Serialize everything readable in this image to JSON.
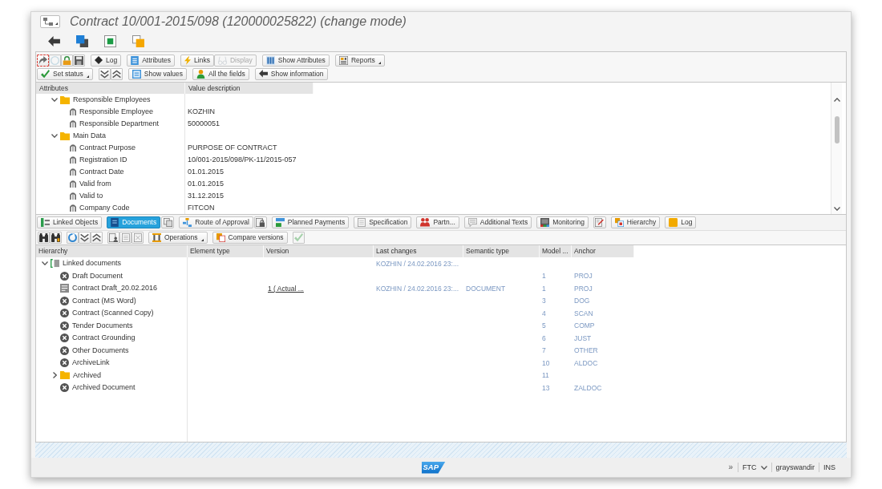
{
  "window": {
    "title": "Contract 10/001-2015/098 (120000025822) (change mode)"
  },
  "attributes_toolbar": {
    "row_1": [
      [
        {
          "kind": "icon",
          "disabled": false,
          "focused": true
        },
        {
          "kind": "icon",
          "disabled": true,
          "focused": false
        },
        {
          "kind": "icon",
          "disabled": false,
          "focused": false
        },
        {
          "kind": "icon",
          "disabled": false,
          "focused": false
        }
      ],
      [
        {
          "kind": "button",
          "label": "Log",
          "disabled": false,
          "focused": false
        }
      ],
      [
        {
          "kind": "button",
          "label": "Attributes",
          "disabled": false,
          "focused": false
        }
      ],
      [
        {
          "kind": "button",
          "label": "Links",
          "disabled": false,
          "focused": false
        },
        {
          "kind": "button",
          "label": "Display",
          "disabled": true,
          "focused": false
        }
      ],
      [
        {
          "kind": "button",
          "label": "Show Attributes",
          "disabled": false,
          "focused": false
        }
      ],
      [
        {
          "kind": "menu",
          "label": "Reports",
          "disabled": false,
          "focused": false
        }
      ]
    ],
    "row_2": [
      [
        {
          "kind": "menu",
          "label": "Set status"
        }
      ],
      [
        {
          "kind": "icon"
        },
        {
          "kind": "icon"
        }
      ],
      [
        {
          "kind": "button",
          "label": "Show values"
        }
      ],
      [
        {
          "kind": "button",
          "label": "All the fields"
        }
      ],
      [
        {
          "kind": "button",
          "label": "Show information"
        }
      ]
    ]
  },
  "attributes": {
    "columns": [
      "Attributes",
      "Value description"
    ],
    "tree": [
      {
        "name": "Responsible Employees",
        "expanded": true,
        "children": [
          {
            "name": "Responsible Employee",
            "value": "KOZHIN"
          },
          {
            "name": "Responsible Department",
            "value": "50000051"
          }
        ]
      },
      {
        "name": "Main Data",
        "expanded": true,
        "children": [
          {
            "name": "Contract Purpose",
            "value": "PURPOSE OF CONTRACT"
          },
          {
            "name": "Registration ID",
            "value": "10/001-2015/098/PK-11/2015-057"
          },
          {
            "name": "Contract Date",
            "value": "01.01.2015"
          },
          {
            "name": "Valid from",
            "value": "01.01.2015"
          },
          {
            "name": "Valid to",
            "value": "31.12.2015"
          },
          {
            "name": "Company Code",
            "value": "FITCON"
          }
        ]
      }
    ]
  },
  "tabs": [
    [
      {
        "kind": "tab",
        "label": "Linked Objects",
        "selected": false
      }
    ],
    [
      {
        "kind": "tab",
        "label": "Documents",
        "selected": true
      },
      {
        "kind": "icon",
        "selected": false
      }
    ],
    [
      {
        "kind": "tab",
        "label": "Route of Approval",
        "selected": false
      },
      {
        "kind": "icon",
        "selected": false
      }
    ],
    [
      {
        "kind": "tab",
        "label": "Planned Payments",
        "selected": false
      }
    ],
    [
      {
        "kind": "tab",
        "label": "Specification",
        "selected": false
      }
    ],
    [
      {
        "kind": "tab",
        "label": "Partn...",
        "selected": false
      }
    ],
    [
      {
        "kind": "tab",
        "label": "Additional Texts",
        "selected": false
      }
    ],
    [
      {
        "kind": "tab",
        "label": "Monitoring",
        "selected": false
      }
    ],
    [
      {
        "kind": "icon",
        "selected": false
      }
    ],
    [
      {
        "kind": "tab",
        "label": "Hierarchy",
        "selected": false
      }
    ],
    [
      {
        "kind": "tab",
        "label": "Log",
        "selected": false
      }
    ]
  ],
  "documents_toolbar": [
    [
      {
        "kind": "icon",
        "disabled": false
      },
      {
        "kind": "icon",
        "disabled": false
      }
    ],
    [
      {
        "kind": "icon",
        "disabled": false
      },
      {
        "kind": "icon",
        "disabled": false
      },
      {
        "kind": "icon",
        "disabled": false
      }
    ],
    [
      {
        "kind": "icon",
        "disabled": false
      },
      {
        "kind": "icon",
        "disabled": false
      },
      {
        "kind": "icon",
        "disabled": false
      }
    ],
    [
      {
        "kind": "menu",
        "label": "Operations",
        "disabled": false
      }
    ],
    [
      {
        "kind": "button",
        "label": "Compare versions",
        "disabled": false
      }
    ],
    [
      {
        "kind": "icon",
        "disabled": true
      }
    ]
  ],
  "documents": {
    "columns": [
      "Hierarchy",
      "Element type",
      "Version",
      "Last changes",
      "Semantic type",
      "Model ...",
      "Anchor"
    ],
    "tree": [
      {
        "kind": "root",
        "name": "Linked documents",
        "expanded": true,
        "last_changes": "KOZHIN / 24.02.2016 23:...",
        "children": [
          {
            "kind": "item",
            "name": "Draft Document",
            "model": "1",
            "anchor": "PROJ"
          },
          {
            "kind": "document",
            "name": "Contract Draft_20.02.2016",
            "version": "1 ( Actual ...",
            "last_changes": "KOZHIN / 24.02.2016 23:...",
            "semantic_type": "DOCUMENT",
            "model": "1",
            "anchor": "PROJ"
          },
          {
            "kind": "item",
            "name": "Contract (MS Word)",
            "model": "3",
            "anchor": "DOG"
          },
          {
            "kind": "item",
            "name": "Contract (Scanned Copy)",
            "model": "4",
            "anchor": "SCAN"
          },
          {
            "kind": "item",
            "name": "Tender Documents",
            "model": "5",
            "anchor": "COMP"
          },
          {
            "kind": "item",
            "name": "Contract Grounding",
            "model": "6",
            "anchor": "JUST"
          },
          {
            "kind": "item",
            "name": "Other Documents",
            "model": "7",
            "anchor": "OTHER"
          },
          {
            "kind": "item",
            "name": "ArchiveLink",
            "model": "10",
            "anchor": "ALDOC"
          },
          {
            "kind": "folder",
            "name": "Archived",
            "expanded": false,
            "model": "11"
          },
          {
            "kind": "item",
            "name": "Archived Document",
            "model": "13",
            "anchor": "ZALDOC"
          }
        ]
      }
    ]
  },
  "status_bar": {
    "logo": "SAP",
    "overflow": "»",
    "system": "FTC",
    "user": "grayswandir",
    "mode": "INS"
  }
}
